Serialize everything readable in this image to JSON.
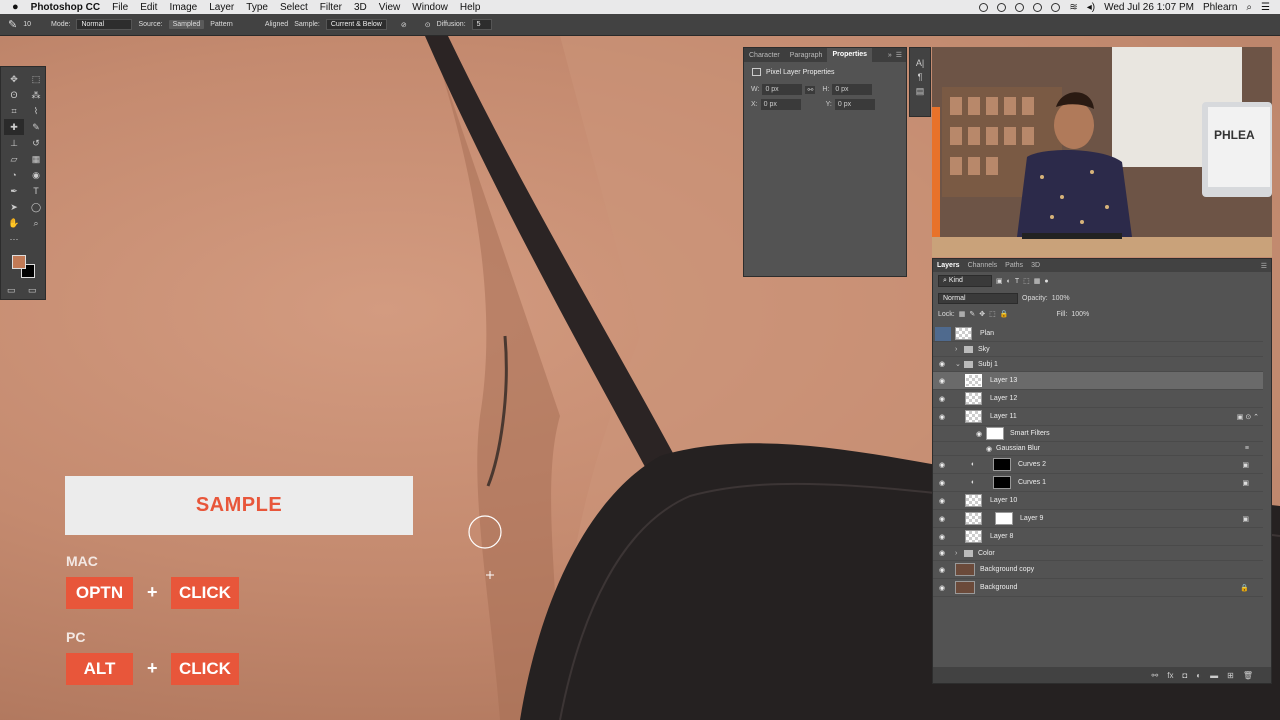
{
  "menubar": {
    "app": "Photoshop CC",
    "items": [
      "File",
      "Edit",
      "Image",
      "Layer",
      "Type",
      "Select",
      "Filter",
      "3D",
      "View",
      "Window",
      "Help"
    ],
    "clock": "Wed Jul 26  1:07 PM",
    "user": "Phlearn"
  },
  "options": {
    "brush_size": "10",
    "mode_label": "Mode:",
    "mode_value": "Normal",
    "source_label": "Source:",
    "source_sampled": "Sampled",
    "source_pattern": "Pattern",
    "aligned": "Aligned",
    "sample_label": "Sample:",
    "sample_value": "Current & Below",
    "diffusion_label": "Diffusion:",
    "diffusion_value": "5"
  },
  "colors": {
    "foreground": "#c17a56",
    "background": "#000000",
    "accent": "#e8563a"
  },
  "properties": {
    "tabs": [
      "Character",
      "Paragraph",
      "Properties"
    ],
    "title": "Pixel Layer Properties",
    "w_label": "W:",
    "w_value": "0 px",
    "h_label": "H:",
    "h_value": "0 px",
    "x_label": "X:",
    "x_value": "0 px",
    "y_label": "Y:",
    "y_value": "0 px"
  },
  "layers": {
    "tabs": [
      "Layers",
      "Channels",
      "Paths",
      "3D"
    ],
    "kind": "Kind",
    "blend": "Normal",
    "opacity_label": "Opacity:",
    "opacity_value": "100%",
    "lock_label": "Lock:",
    "fill_label": "Fill:",
    "fill_value": "100%",
    "items": [
      "Plan",
      "Sky",
      "Subj 1",
      "Layer 13",
      "Layer 12",
      "Layer 11",
      "Smart Filters",
      "Gaussian Blur",
      "Curves 2",
      "Curves 1",
      "Layer 10",
      "Layer 9",
      "Layer 8",
      "Color",
      "Background copy",
      "Background"
    ]
  },
  "overlay": {
    "title": "SAMPLE",
    "mac_label": "MAC",
    "mac_key": "OPTN",
    "pc_label": "PC",
    "pc_key": "ALT",
    "plus": "+",
    "click": "CLICK"
  },
  "video": {
    "sign": "PHLEA"
  }
}
